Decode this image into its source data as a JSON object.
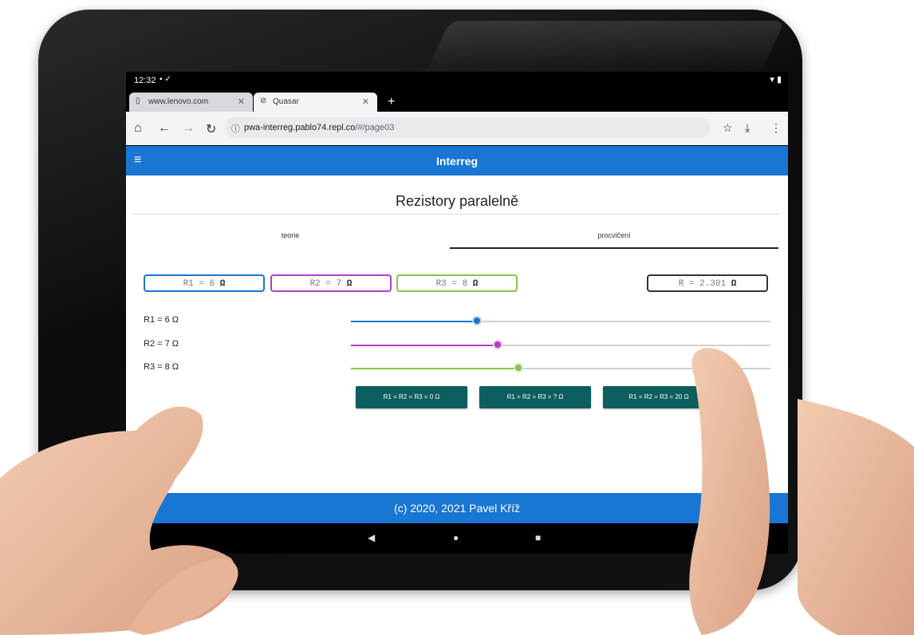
{
  "status_bar": {
    "time": "12:32",
    "left_icons": [
      "notification-icon",
      "check-icon"
    ],
    "right_icons": [
      "wifi-icon",
      "battery-icon"
    ]
  },
  "browser": {
    "tabs": [
      {
        "label": "www.lenovo.com",
        "icon": "page-icon",
        "active": false
      },
      {
        "label": "Quasar",
        "icon": "globe-icon",
        "active": true
      }
    ],
    "url_host": "pwa-interreg.pablo74.repl.co",
    "url_path": "/#/page03"
  },
  "app": {
    "title": "Interreg",
    "header_color": "#1976d2"
  },
  "page": {
    "heading": "Rezistory paralelně",
    "tabs": [
      {
        "label": "teorie",
        "active": false
      },
      {
        "label": "procvičení",
        "active": true
      }
    ],
    "resistors": [
      {
        "name": "R1",
        "value": 6,
        "box_text": "R1 =  6 ",
        "unit": "Ω",
        "slider_label": "R1 = 6 Ω",
        "color": "#1976d2",
        "slider_fraction": 0.3
      },
      {
        "name": "R2",
        "value": 7,
        "box_text": "R2 =  7 ",
        "unit": "Ω",
        "slider_label": "R2 = 7 Ω",
        "color": "#b23ec6",
        "slider_fraction": 0.35
      },
      {
        "name": "R3",
        "value": 8,
        "box_text": "R3 =  8 ",
        "unit": "Ω",
        "slider_label": "R3 = 8 Ω",
        "color": "#8bc34a",
        "slider_fraction": 0.4
      }
    ],
    "total": {
      "box_text": "R =  2.301 ",
      "unit": "Ω"
    },
    "preset_buttons": [
      "R1 = R2 = R3 = 0 Ω",
      "R1 = R2 = R3 = ? Ω",
      "R1 = R2 = R3 = 20 Ω"
    ],
    "button_color": "#0d5e5e"
  },
  "footer": {
    "text": "(c) 2020, 2021 Pavel Kříž"
  },
  "android_nav": [
    "back-icon",
    "home-icon",
    "recents-icon"
  ]
}
